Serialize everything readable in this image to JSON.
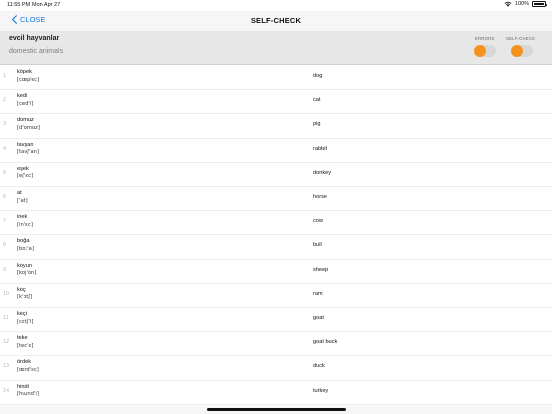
{
  "status_bar": {
    "time": "11:55 PM",
    "date": "Mon Apr 27",
    "battery_percent": "100%"
  },
  "nav": {
    "back_label": "CLOSE",
    "title": "SELF-CHECK"
  },
  "header": {
    "title": "evcil hayvanlar",
    "subtitle": "domestic animals",
    "errors_label": "ERRORS",
    "selfcheck_label": "SELF-CHECK",
    "errors_toggle": "off",
    "selfcheck_toggle": "off",
    "accent_color": "#f5921e"
  },
  "rows": [
    {
      "num": "1",
      "word": "köpek",
      "ipa": "[cœpʲɛc]",
      "translation": "dog"
    },
    {
      "num": "2",
      "word": "kedi",
      "ipa": "[ced'i]",
      "translation": "cat"
    },
    {
      "num": "3",
      "word": "domuz",
      "ipa": "[d'omoz]",
      "translation": "pig"
    },
    {
      "num": "4",
      "word": "tavşan",
      "ipa": "[tavʃ'an]",
      "translation": "rabbit"
    },
    {
      "num": "5",
      "word": "eşek",
      "ipa": "[eʃ'ɛc]",
      "translation": "donkey"
    },
    {
      "num": "6",
      "word": "at",
      "ipa": "['at]",
      "translation": "horse"
    },
    {
      "num": "7",
      "word": "inek",
      "ipa": "[in'ɛc]",
      "translation": "cow"
    },
    {
      "num": "8",
      "word": "boğa",
      "ipa": "[boː'a]",
      "translation": "bull"
    },
    {
      "num": "9",
      "word": "koyun",
      "ipa": "[koj'on]",
      "translation": "sheep"
    },
    {
      "num": "10",
      "word": "koç",
      "ipa": "[k'ɔtʃ]",
      "translation": "ram"
    },
    {
      "num": "11",
      "word": "keçi",
      "ipa": "[cɛtʃ'i]",
      "translation": "goat"
    },
    {
      "num": "12",
      "word": "teke",
      "ipa": "[tec'ɛ]",
      "translation": "goat buck"
    },
    {
      "num": "13",
      "word": "ördek",
      "ipa": "[œrd'ɛc]",
      "translation": "duck"
    },
    {
      "num": "14",
      "word": "hindi",
      "ipa": "[hɯnd'i]",
      "translation": "turkey"
    }
  ]
}
